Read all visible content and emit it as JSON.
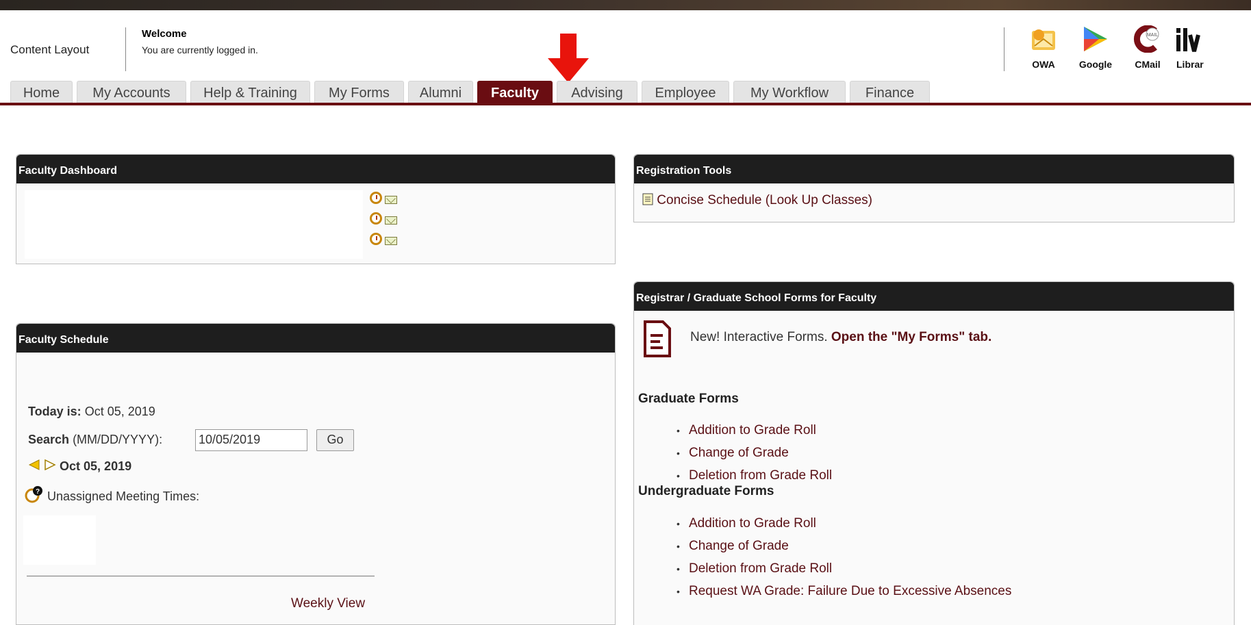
{
  "header": {
    "content_layout": "Content Layout",
    "welcome": "Welcome",
    "logged_in": "You are currently logged in.",
    "quick_links": [
      {
        "label": "OWA",
        "icon": "owa-icon"
      },
      {
        "label": "Google",
        "icon": "google-icon"
      },
      {
        "label": "CMail",
        "icon": "cmail-icon"
      },
      {
        "label": "Librar",
        "icon": "library-icon"
      }
    ]
  },
  "tabs": [
    "Home",
    "My Accounts",
    "Help & Training",
    "My Forms",
    "Alumni",
    "Faculty",
    "Advising",
    "Employee",
    "My Workflow",
    "Finance"
  ],
  "active_tab": "Faculty",
  "faculty_dashboard": {
    "title": "Faculty Dashboard"
  },
  "faculty_schedule": {
    "title": "Faculty Schedule",
    "today_label": "Today is:",
    "today_value": "Oct 05, 2019",
    "search_label": "Search",
    "search_format": "(MM/DD/YYYY):",
    "search_value": "10/05/2019",
    "go_label": "Go",
    "current_date": "Oct 05, 2019",
    "unassigned": "Unassigned Meeting Times:",
    "weekly_view": "Weekly View"
  },
  "registration_tools": {
    "title": "Registration Tools",
    "link": "Concise Schedule (Look Up Classes)"
  },
  "registrar_forms": {
    "title": "Registrar / Graduate School Forms for Faculty",
    "notice": "New! Interactive Forms.",
    "notice_link": "Open the \"My Forms\" tab.",
    "graduate_heading": "Graduate Forms",
    "graduate_forms": [
      "Addition to Grade Roll",
      "Change of Grade",
      "Deletion from Grade Roll"
    ],
    "undergrad_heading": "Undergraduate Forms",
    "undergrad_forms": [
      "Addition to Grade Roll",
      "Change of Grade",
      "Deletion from Grade Roll",
      "Request WA Grade: Failure Due to Excessive Absences"
    ]
  },
  "colors": {
    "accent": "#6a0d12",
    "panel_header": "#1e1e1e",
    "arrow": "#e8140c"
  }
}
